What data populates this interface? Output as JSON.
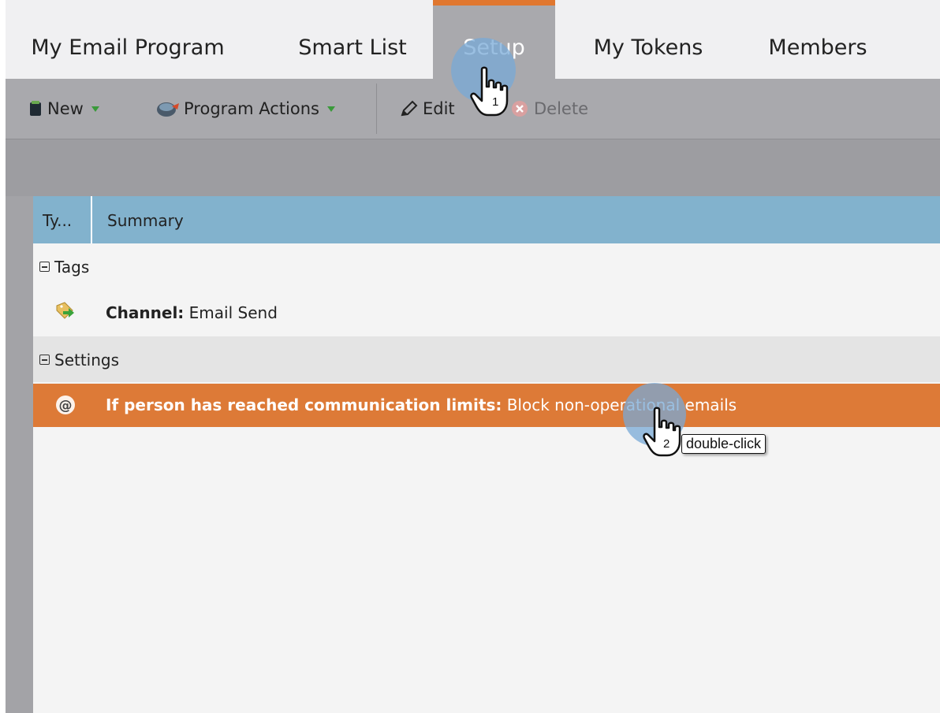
{
  "tabs": [
    {
      "label": "My Email Program"
    },
    {
      "label": "Smart List"
    },
    {
      "label": "Setup"
    },
    {
      "label": "My Tokens"
    },
    {
      "label": "Members"
    }
  ],
  "active_tab": "Setup",
  "toolbar": {
    "new_label": "New",
    "program_actions_label": "Program Actions",
    "edit_label": "Edit",
    "delete_label": "Delete"
  },
  "grid": {
    "columns": [
      "Ty...",
      "Summary"
    ],
    "groups": [
      {
        "name": "Tags",
        "rows": [
          {
            "label": "Channel:",
            "value": "Email Send",
            "icon": "tag-icon"
          }
        ]
      },
      {
        "name": "Settings",
        "rows": [
          {
            "label": "If person has reached communication limits:",
            "value": "Block non-operational emails",
            "icon": "at-sign-icon",
            "selected": true
          }
        ]
      }
    ]
  },
  "annotations": {
    "step1": "1",
    "step2": "2",
    "step2_action": "double-click"
  },
  "colors": {
    "accent_orange": "#dd7a37",
    "header_blue": "#82b2cd",
    "toolbar_gray": "#a9a9ad"
  }
}
